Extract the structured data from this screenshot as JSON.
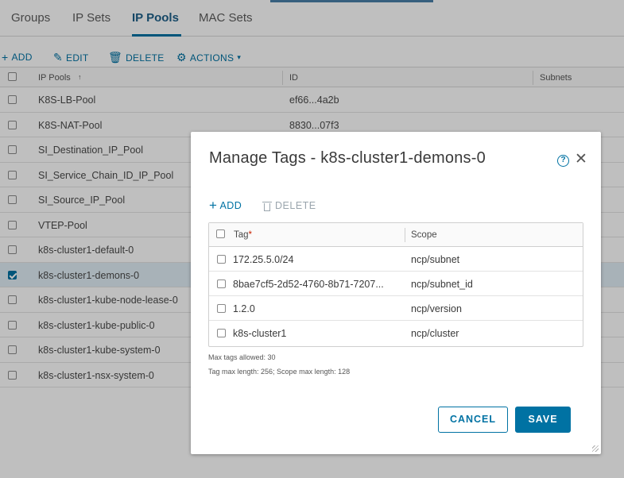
{
  "tabs": [
    {
      "label": "Groups"
    },
    {
      "label": "IP Sets"
    },
    {
      "label": "IP Pools",
      "active": true
    },
    {
      "label": "MAC Sets"
    }
  ],
  "toolbar": {
    "add": "ADD",
    "edit": "EDIT",
    "delete": "DELETE",
    "actions": "ACTIONS"
  },
  "table": {
    "columns": [
      "IP Pools",
      "ID",
      "Subnets"
    ],
    "rows": [
      {
        "name": "K8S-LB-Pool",
        "id": "ef66...4a2b",
        "selected": false
      },
      {
        "name": "K8S-NAT-Pool",
        "id": "8830...07f3",
        "selected": false
      },
      {
        "name": "SI_Destination_IP_Pool",
        "id": "",
        "selected": false
      },
      {
        "name": "SI_Service_Chain_ID_IP_Pool",
        "id": "",
        "selected": false
      },
      {
        "name": "SI_Source_IP_Pool",
        "id": "",
        "selected": false
      },
      {
        "name": "VTEP-Pool",
        "id": "",
        "selected": false
      },
      {
        "name": "k8s-cluster1-default-0",
        "id": "",
        "selected": false
      },
      {
        "name": "k8s-cluster1-demons-0",
        "id": "",
        "selected": true
      },
      {
        "name": "k8s-cluster1-kube-node-lease-0",
        "id": "",
        "selected": false
      },
      {
        "name": "k8s-cluster1-kube-public-0",
        "id": "",
        "selected": false
      },
      {
        "name": "k8s-cluster1-kube-system-0",
        "id": "",
        "selected": false
      },
      {
        "name": "k8s-cluster1-nsx-system-0",
        "id": "",
        "selected": false
      }
    ]
  },
  "modal": {
    "title": "Manage Tags - k8s-cluster1-demons-0",
    "help_glyph": "?",
    "close_glyph": "✕",
    "add_label": "ADD",
    "delete_label": "DELETE",
    "columns": {
      "tag": "Tag",
      "required_mark": "*",
      "scope": "Scope"
    },
    "tags": [
      {
        "tag": "172.25.5.0/24",
        "scope": "ncp/subnet"
      },
      {
        "tag": "8bae7cf5-2d52-4760-8b71-7207...",
        "scope": "ncp/subnet_id"
      },
      {
        "tag": "1.2.0",
        "scope": "ncp/version"
      },
      {
        "tag": "k8s-cluster1",
        "scope": "ncp/cluster"
      }
    ],
    "note_max_tags": "Max tags allowed: 30",
    "note_max_length": "Tag max length: 256; Scope max length: 128",
    "cancel_label": "CANCEL",
    "save_label": "SAVE"
  },
  "colors": {
    "accent": "#0072a3",
    "required": "#c92100",
    "selected_row": "#e1eef6"
  }
}
